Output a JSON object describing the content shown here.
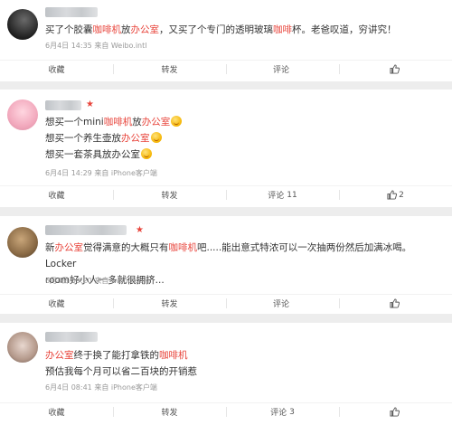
{
  "actions": {
    "favorite": "收藏",
    "repost": "转发",
    "comment": "评论"
  },
  "posts": [
    {
      "text": [
        [
          {
            "t": "买了个胶囊",
            "h": false
          },
          {
            "t": "咖啡机",
            "h": true
          },
          {
            "t": "放",
            "h": false
          },
          {
            "t": "办公室",
            "h": true
          },
          {
            "t": "，又买了个专门的透明玻璃",
            "h": false
          },
          {
            "t": "咖啡",
            "h": true
          },
          {
            "t": "杯。老爸叹道，穷讲究！",
            "h": false
          }
        ]
      ],
      "meta": "6月4日 14:35 来自 Weibo.intl",
      "comment_count": "",
      "like_count": ""
    },
    {
      "text": [
        [
          {
            "t": "想买一个mini",
            "h": false
          },
          {
            "t": "咖啡机",
            "h": true
          },
          {
            "t": "放",
            "h": false
          },
          {
            "t": "办公室",
            "h": true
          },
          {
            "t": "",
            "h": false,
            "emoji": true
          }
        ],
        [
          {
            "t": "想买一个养生壶放",
            "h": false
          },
          {
            "t": "办公室",
            "h": true
          },
          {
            "t": "",
            "h": false,
            "emoji": true
          }
        ],
        [
          {
            "t": "想买一套茶具放办公室",
            "h": false
          },
          {
            "t": "",
            "h": false,
            "emoji": true
          }
        ]
      ],
      "meta": "6月4日 14:29 来自 iPhone客户端",
      "comment_count": "11",
      "like_count": "2"
    },
    {
      "text": [
        [
          {
            "t": "新",
            "h": false
          },
          {
            "t": "办公室",
            "h": true
          },
          {
            "t": "觉得满意的大概只有",
            "h": false
          },
          {
            "t": "咖啡机",
            "h": true
          },
          {
            "t": "吧.....能出意式特浓可以一次抽两份然后加满冰喝。Locker",
            "h": false
          }
        ],
        [
          {
            "t": "room好小人一多就很拥挤...",
            "h": false
          }
        ]
      ],
      "meta": "6月4日 09:20 来自 weibo.com",
      "comment_count": "",
      "like_count": ""
    },
    {
      "text": [
        [
          {
            "t": "办公室",
            "h": true
          },
          {
            "t": "终于换了能打拿铁的",
            "h": false
          },
          {
            "t": "咖啡机",
            "h": true
          }
        ],
        [
          {
            "t": "预估我每个月可以省二百块的开销惹",
            "h": false
          }
        ]
      ],
      "meta": "6月4日 08:41 来自 iPhone客户端",
      "comment_count": "3",
      "like_count": ""
    }
  ]
}
